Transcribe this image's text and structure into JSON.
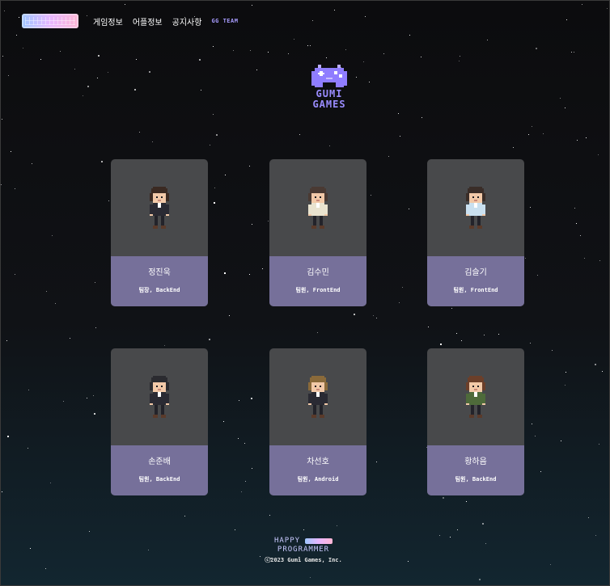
{
  "header": {
    "logo_icon": "keyboard-logo-icon",
    "nav": [
      {
        "label": "게임정보"
      },
      {
        "label": "어플정보"
      },
      {
        "label": "공지사항"
      },
      {
        "label": "GG TEAM"
      }
    ]
  },
  "brand": {
    "icon": "gamepad-icon",
    "line1": "GUMI",
    "line2": "GAMES",
    "accent": "#9a8cff"
  },
  "members": [
    {
      "name": "정진욱",
      "role": "팀장, BackEnd",
      "hair": "#3b2a22",
      "skin": "#f2c9a8",
      "outfit": "#2a2a33"
    },
    {
      "name": "김수민",
      "role": "팀원, FrontEnd",
      "hair": "#4a3a33",
      "skin": "#f2c9a8",
      "outfit": "#e9e3cf"
    },
    {
      "name": "김슬기",
      "role": "팀원, FrontEnd",
      "hair": "#3a2d28",
      "skin": "#f2c9a8",
      "outfit": "#c9e0f0"
    },
    {
      "name": "손준배",
      "role": "팀원, BackEnd",
      "hair": "#2b2b30",
      "skin": "#f2c9a8",
      "outfit": "#2a2a33"
    },
    {
      "name": "차선호",
      "role": "팀원, Android",
      "hair": "#8a6a3a",
      "skin": "#f2c9a8",
      "outfit": "#2a2a33"
    },
    {
      "name": "황하음",
      "role": "팀원, BackEnd",
      "hair": "#6b3f2a",
      "skin": "#f2c9a8",
      "outfit": "#4e6a3a"
    }
  ],
  "footer": {
    "line1": "HAPPY",
    "line2": "PROGRAMMER",
    "copyright": "ⓒ2023 Gumi Games, Inc."
  },
  "colors": {
    "card_bg": "#48494b",
    "card_info": "#76709a",
    "nav_accent": "#a89cff"
  }
}
